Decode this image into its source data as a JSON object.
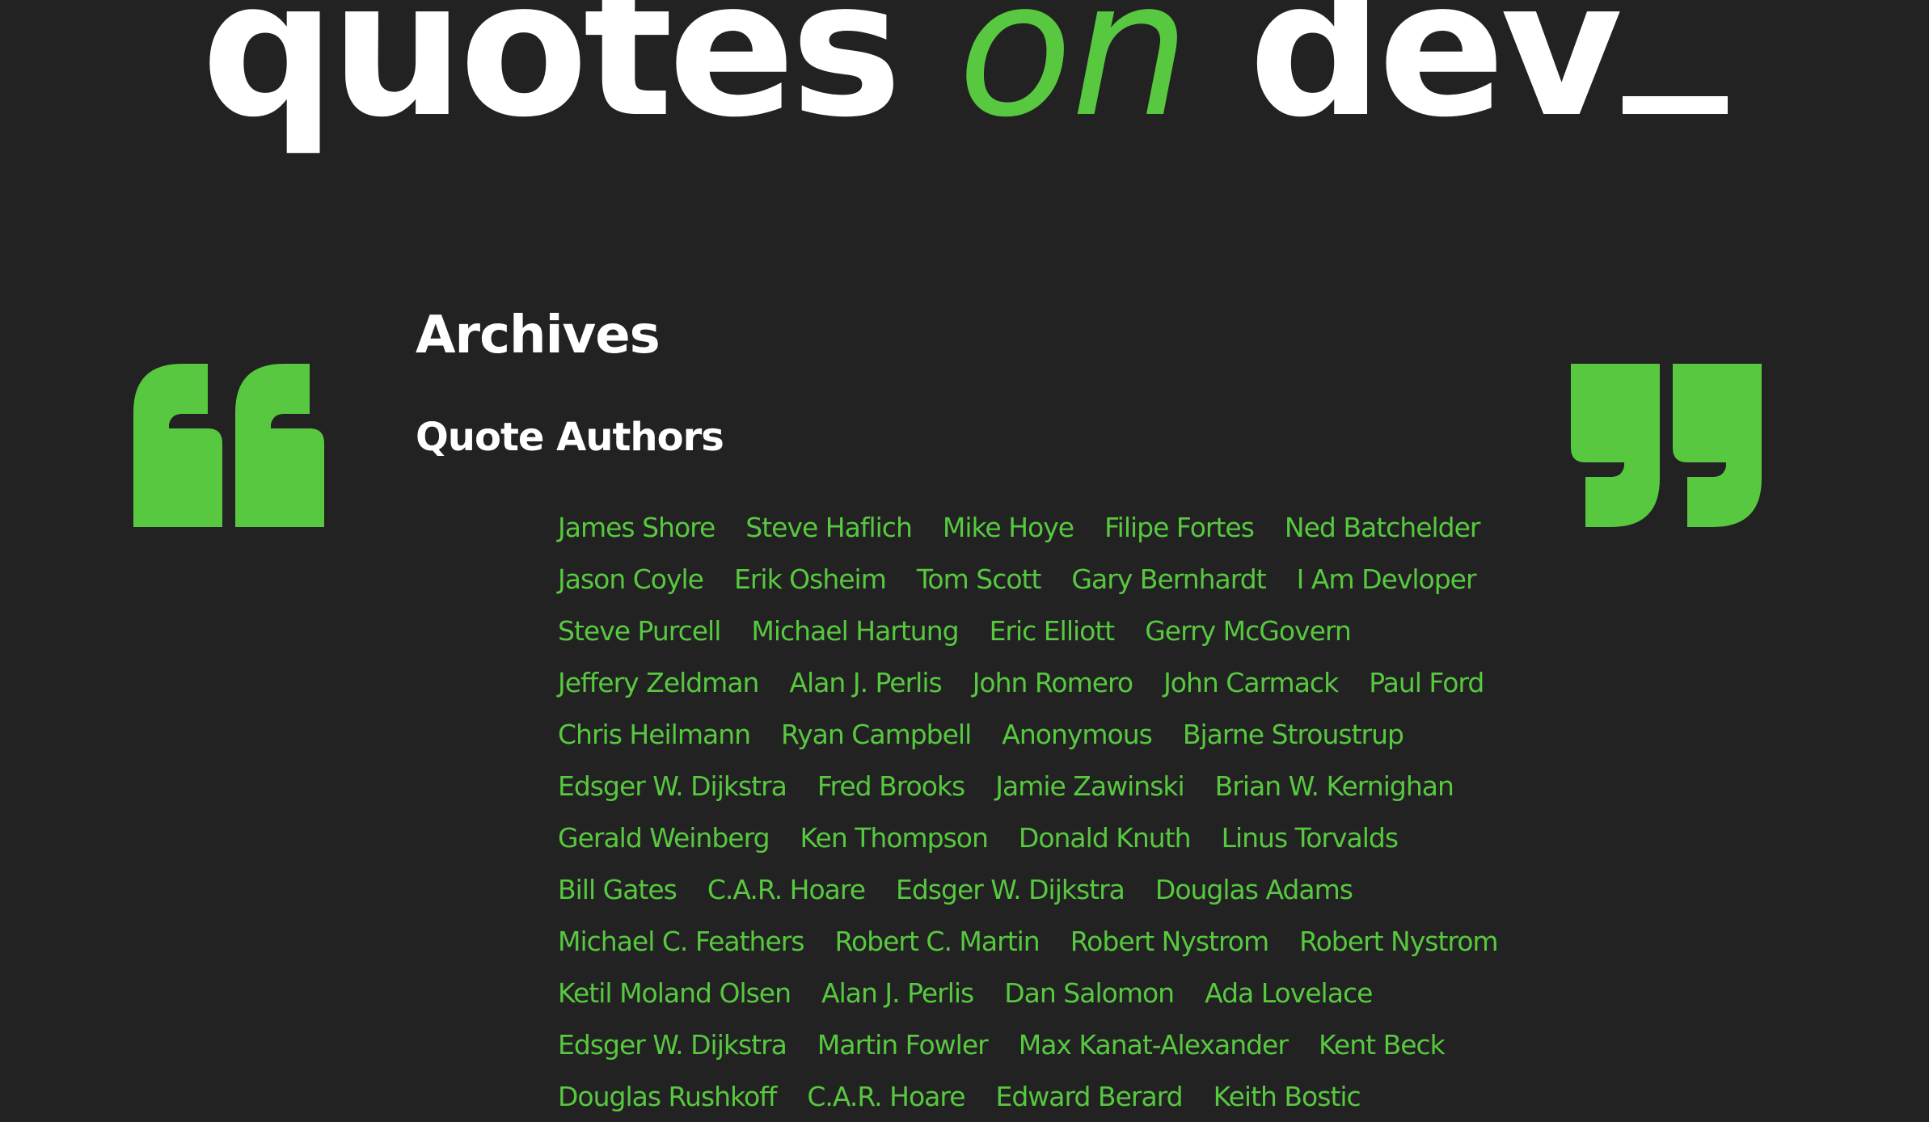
{
  "site": {
    "logo_quotes": "quotes",
    "logo_on": "on",
    "logo_dev": "dev"
  },
  "colors": {
    "background": "#222222",
    "accent": "#57c83f",
    "text": "#ffffff"
  },
  "decor": {
    "left_icon": "open-quote-icon",
    "right_icon": "close-quote-icon"
  },
  "page": {
    "title": "Archives",
    "section_title": "Quote Authors"
  },
  "authors": [
    [
      "James Shore",
      "Steve Haflich",
      "Mike Hoye",
      "Filipe Fortes",
      "Ned Batchelder"
    ],
    [
      "Jason Coyle",
      "Erik Osheim",
      "Tom Scott",
      "Gary Bernhardt",
      "I Am Devloper"
    ],
    [
      "Steve Purcell",
      "Michael Hartung",
      "Eric Elliott",
      "Gerry McGovern"
    ],
    [
      "Jeffery Zeldman",
      "Alan J. Perlis",
      "John Romero",
      "John Carmack",
      "Paul Ford"
    ],
    [
      "Chris Heilmann",
      "Ryan Campbell",
      "Anonymous",
      "Bjarne Stroustrup"
    ],
    [
      "Edsger W. Dijkstra",
      "Fred Brooks",
      "Jamie Zawinski",
      "Brian W. Kernighan"
    ],
    [
      "Gerald Weinberg",
      "Ken Thompson",
      "Donald Knuth",
      "Linus Torvalds"
    ],
    [
      "Bill Gates",
      "C.A.R. Hoare",
      "Edsger W. Dijkstra",
      "Douglas Adams"
    ],
    [
      "Michael C. Feathers",
      "Robert C. Martin",
      "Robert Nystrom",
      "Robert Nystrom"
    ],
    [
      "Ketil Moland Olsen",
      "Alan J. Perlis",
      "Dan Salomon",
      "Ada Lovelace"
    ],
    [
      "Edsger W. Dijkstra",
      "Martin Fowler",
      "Max Kanat-Alexander",
      "Kent Beck"
    ],
    [
      "Douglas Rushkoff",
      "C.A.R. Hoare",
      "Edward Berard",
      "Keith Bostic"
    ]
  ]
}
